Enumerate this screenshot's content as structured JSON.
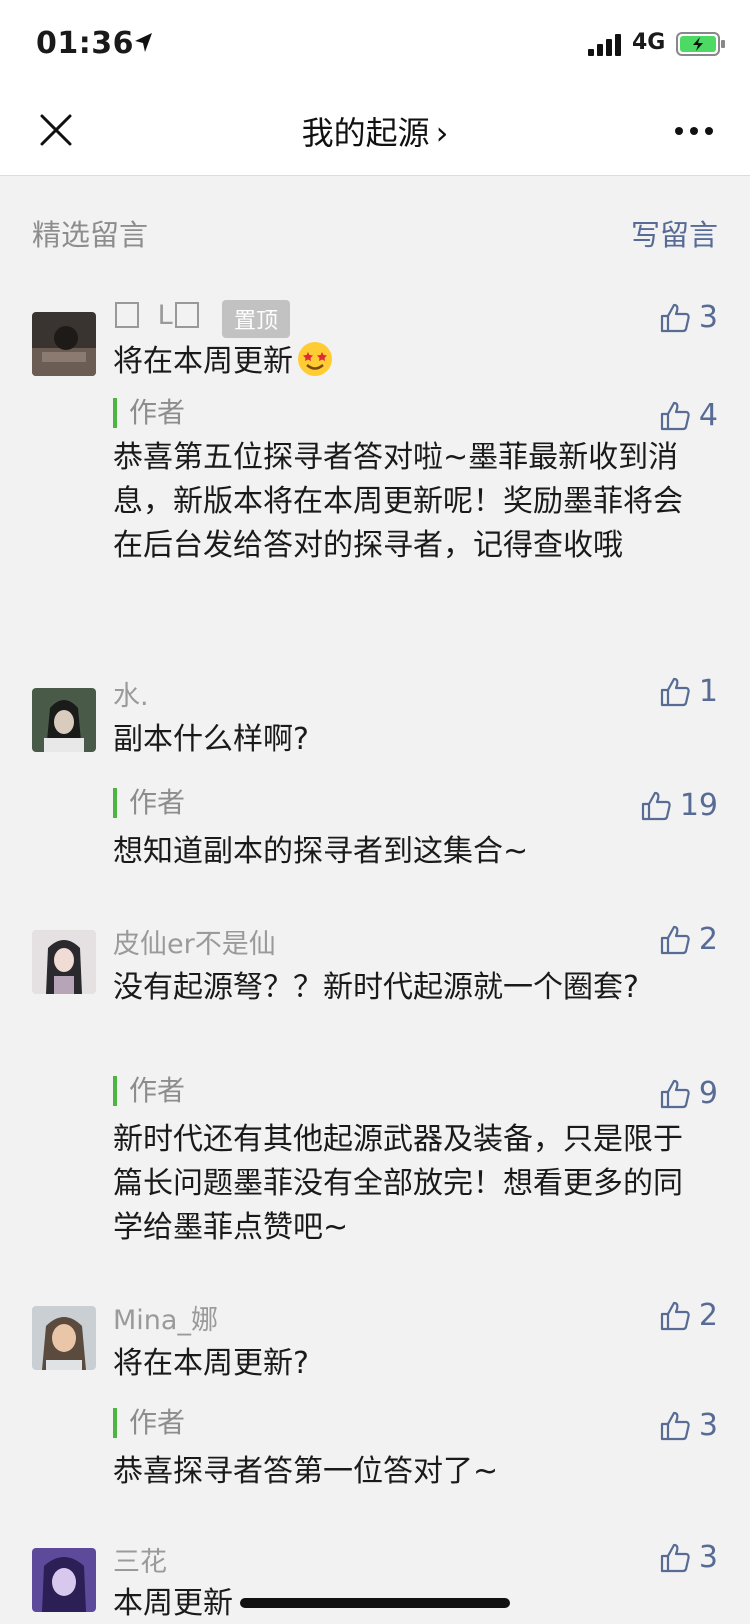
{
  "status_bar": {
    "time": "01:36",
    "network": "4G"
  },
  "header": {
    "title": "我的起源",
    "title_chevron": "›"
  },
  "section": {
    "title": "精选留言",
    "write_link": "写留言"
  },
  "comments": [
    {
      "nickname_prefix": "",
      "nickname_middle": "L",
      "pin_label": "置顶",
      "text": "将在本周更新",
      "likes": "3",
      "reply_label": "作者",
      "reply_likes": "4",
      "reply_text": "恭喜第五位探寻者答对啦~墨菲最新收到消息，新版本将在本周更新呢！奖励墨菲将会在后台发给答对的探寻者，记得查收哦"
    },
    {
      "nickname": "水.",
      "text": "副本什么样啊?",
      "likes": "1",
      "reply_label": "作者",
      "reply_likes": "19",
      "reply_text": "想知道副本的探寻者到这集合~"
    },
    {
      "nickname": "皮仙er不是仙",
      "text": "没有起源弩？？新时代起源就一个圈套?",
      "likes": "2",
      "reply_label": "作者",
      "reply_likes": "9",
      "reply_text": "新时代还有其他起源武器及装备，只是限于篇长问题墨菲没有全部放完！想看更多的同学给墨菲点赞吧~"
    },
    {
      "nickname": "Mina_娜",
      "text": "将在本周更新?",
      "likes": "2",
      "reply_label": "作者",
      "reply_likes": "3",
      "reply_text": "恭喜探寻者答第一位答对了~"
    },
    {
      "nickname": "三花",
      "text": "本周更新",
      "likes": "3"
    }
  ],
  "icons": {
    "close": "close-icon",
    "more": "more-icon",
    "like": "thumbs-up-icon"
  },
  "colors": {
    "link": "#576b95",
    "author_bar": "#4cb541",
    "background": "#f2f2f2"
  }
}
